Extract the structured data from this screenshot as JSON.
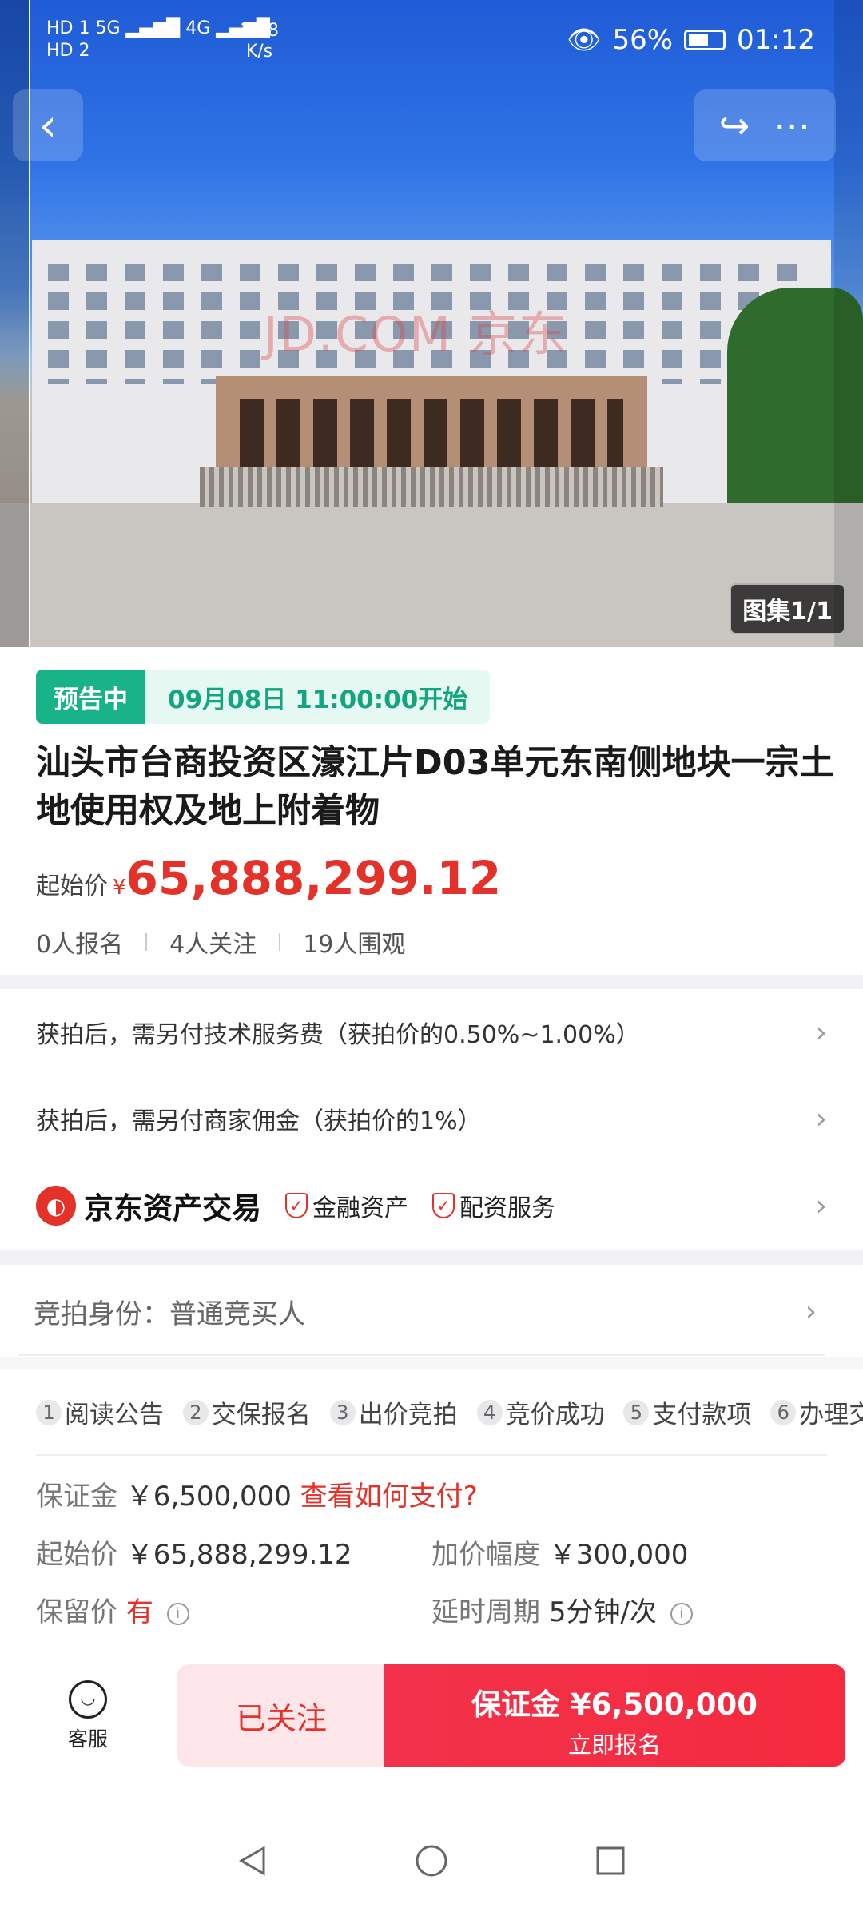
{
  "status_bar": {
    "sim1": "HD 1",
    "sim2": "HD 2",
    "net1": "5G",
    "net2": "4G",
    "speed_value": "17.8",
    "speed_unit": "K/s",
    "battery": "56%",
    "time": "01:12"
  },
  "hero": {
    "watermark": "JD.COM 京东",
    "gallery_counter": "图集1/1"
  },
  "listing": {
    "status_tag": "预告中",
    "start_time": "09月08日 11:00:00开始",
    "title": "汕头市台商投资区濠江片D03单元东南侧地块一宗土地使用权及地上附着物",
    "price_label": "起始价",
    "price_currency": "¥",
    "price_value": "65,888,299.12",
    "stats": [
      "0人报名",
      "4人关注",
      "19人围观"
    ]
  },
  "fees": {
    "tech_fee": "获拍后，需另付技术服务费（获拍价的0.50%~1.00%）",
    "commission": "获拍后，需另付商家佣金（获拍价的1%）"
  },
  "seller": {
    "name": "京东资产交易",
    "badge1": "金融资产",
    "badge2": "配资服务"
  },
  "identity": {
    "text": "竞拍身份：普通竞买人"
  },
  "steps": [
    {
      "n": "1",
      "label": "阅读公告"
    },
    {
      "n": "2",
      "label": "交保报名"
    },
    {
      "n": "3",
      "label": "出价竞拍"
    },
    {
      "n": "4",
      "label": "竞价成功"
    },
    {
      "n": "5",
      "label": "支付款项"
    },
    {
      "n": "6",
      "label": "办理交割"
    }
  ],
  "details": {
    "deposit_label": "保证金",
    "deposit_value": "￥6,500,000",
    "deposit_link": "查看如何支付?",
    "start_label": "起始价",
    "start_value": "￥65,888,299.12",
    "increment_label": "加价幅度",
    "increment_value": "￥300,000",
    "reserve_label": "保留价",
    "reserve_value": "有",
    "delay_label": "延时周期",
    "delay_value": "5分钟/次"
  },
  "bottom_bar": {
    "service_label": "客服",
    "follow_label": "已关注",
    "sign_line1": "保证金 ¥6,500,000",
    "sign_line2": "立即报名"
  }
}
